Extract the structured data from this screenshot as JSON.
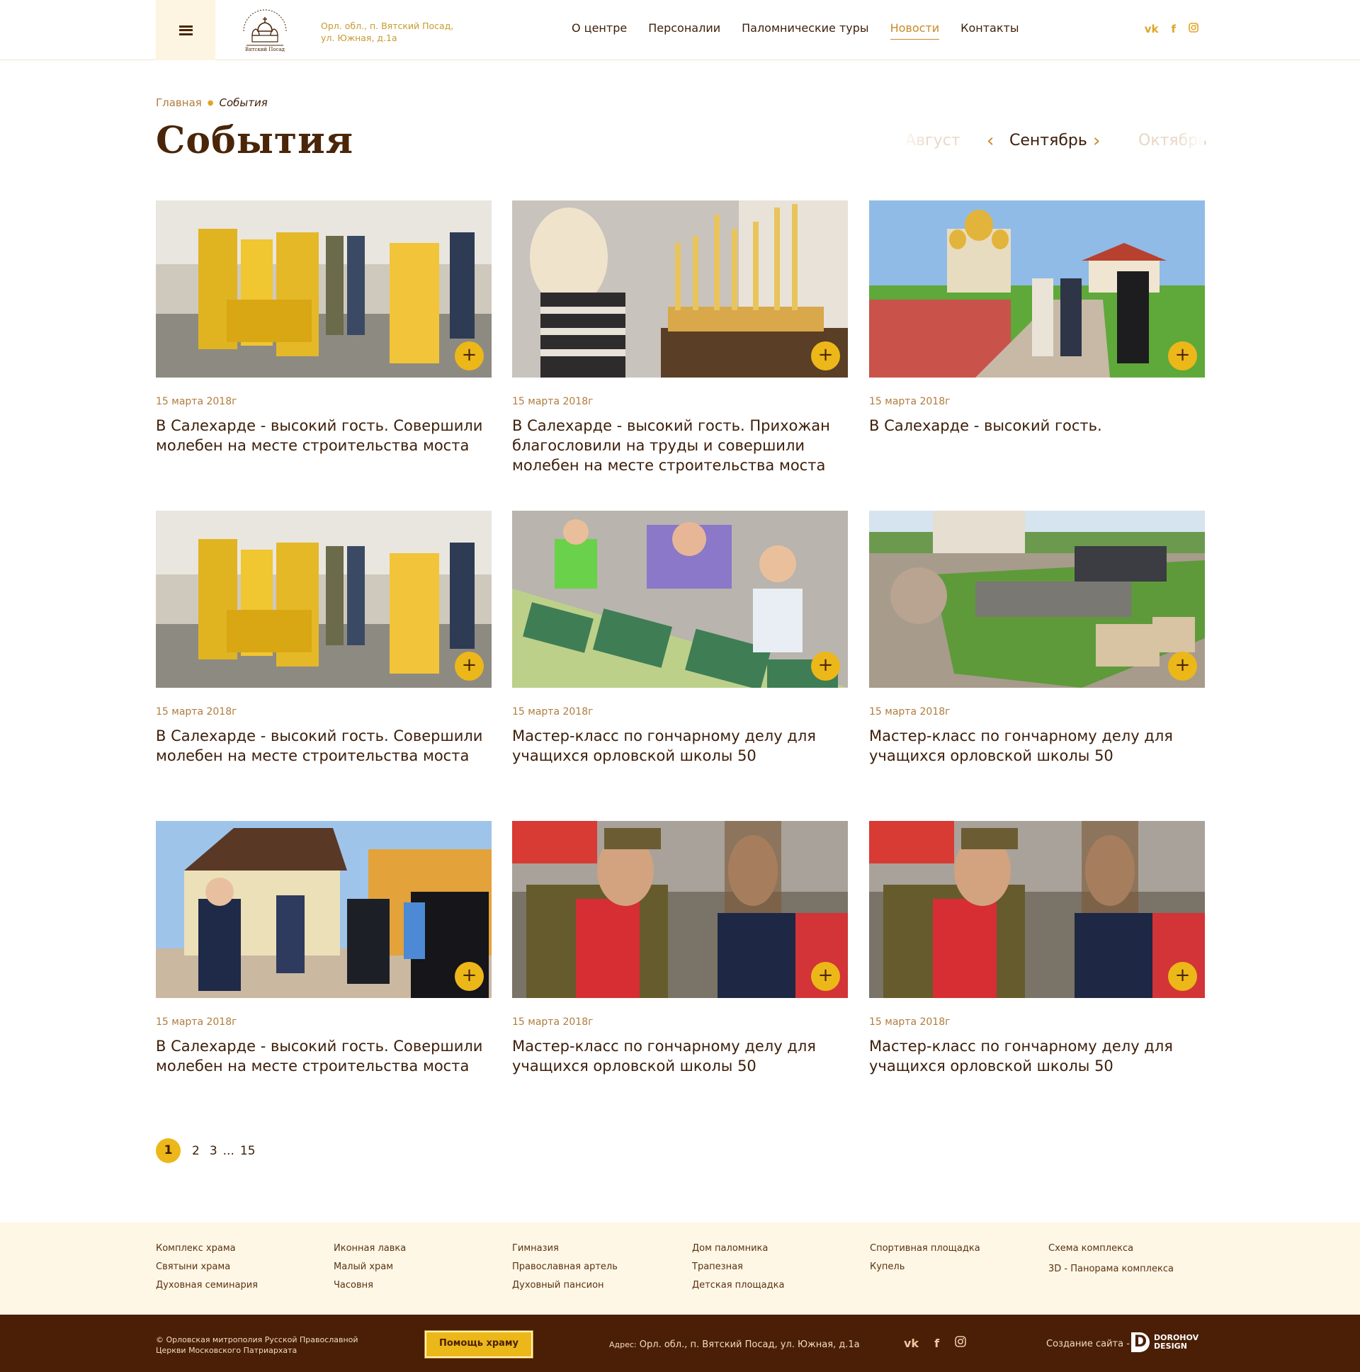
{
  "header": {
    "address": "Орл. обл., п. Вятский Посад, ул. Южная, д.1а",
    "logo_text": "Духовно-православный центр Вятский Посад",
    "nav": [
      {
        "label": "О центре",
        "active": false
      },
      {
        "label": "Персоналии",
        "active": false
      },
      {
        "label": "Паломнические туры",
        "active": false
      },
      {
        "label": "Новости",
        "active": true
      },
      {
        "label": "Контакты",
        "active": false
      }
    ],
    "social": [
      "vk-icon",
      "facebook-icon",
      "instagram-icon"
    ]
  },
  "breadcrumb": {
    "home": "Главная",
    "current": "События"
  },
  "page_title": "События",
  "months": {
    "prev": "Август",
    "current": "Сентябрь",
    "next": "Октябрь"
  },
  "cards": [
    {
      "date": "15 марта 2018г",
      "title": "В Салехарде - высокий гость. Совершили молебен на месте строительства моста",
      "photo": "priests-ceremony"
    },
    {
      "date": "15 марта 2018г",
      "title": "В Салехарде - высокий гость. Прихожан благословили на труды и совершили молебен на месте строительства моста",
      "photo": "girl-candles"
    },
    {
      "date": "15 марта 2018г",
      "title": "В Салехарде - высокий гость.",
      "photo": "cathedral-walk"
    },
    {
      "date": "15 марта 2018г",
      "title": "В Салехарде - высокий гость. Совершили молебен на месте строительства моста",
      "photo": "priests-ceremony"
    },
    {
      "date": "15 марта 2018г",
      "title": "Мастер-класс по гончарному делу для учащихся орловской школы   50",
      "photo": "kids-pottery"
    },
    {
      "date": "15 марта 2018г",
      "title": "Мастер-класс по гончарному делу для учащихся орловской школы   50",
      "photo": "stage-park"
    },
    {
      "date": "15 марта 2018г",
      "title": "В Салехарде - высокий гость. Совершили молебен на месте строительства моста",
      "photo": "chapel-guests"
    },
    {
      "date": "15 марта 2018г",
      "title": "Мастер-класс по гончарному делу для учащихся орловской школы   50",
      "photo": "interview"
    },
    {
      "date": "15 марта 2018г",
      "title": "Мастер-класс по гончарному делу для учащихся орловской школы   50",
      "photo": "interview"
    }
  ],
  "pagination": {
    "pages": [
      "1",
      "2",
      "3",
      "...",
      "15"
    ],
    "current": "1"
  },
  "footer_links": [
    [
      "Комплекс храма",
      "Святыни храма",
      "Духовная семинария"
    ],
    [
      "Иконная лавка",
      "Малый храм",
      "Часовня"
    ],
    [
      "Гимназия",
      "Православная артель",
      "Духовный пансион"
    ],
    [
      "Дом паломника",
      "Трапезная",
      "Детская площадка"
    ],
    [
      "Спортивная площадка",
      "Купель"
    ],
    [
      "Схема комплекса",
      "3D - Панорама комплекса"
    ]
  ],
  "bottom": {
    "copyright": "© Орловская митрополия Русской Православной Церкви Московского Патриархата",
    "help_button": "Помощь храму",
    "address_label": "Адрес:",
    "address": "Орл. обл.,  п. Вятский Посад, ул. Южная, д.1а",
    "made_by": "Создание сайта -",
    "studio_mark": "D",
    "studio_name_1": "DOROHOV",
    "studio_name_2": "DESIGN"
  },
  "colors": {
    "accent": "#ecb719",
    "brown": "#4a1f05",
    "cream": "#fef7e6",
    "link": "#c9892a"
  }
}
